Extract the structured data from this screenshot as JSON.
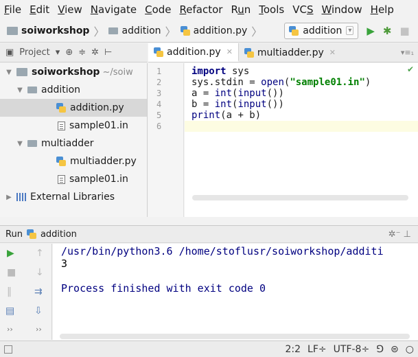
{
  "menubar": {
    "items": [
      {
        "pre": "",
        "u": "F",
        "post": "ile"
      },
      {
        "pre": "",
        "u": "E",
        "post": "dit"
      },
      {
        "pre": "",
        "u": "V",
        "post": "iew"
      },
      {
        "pre": "",
        "u": "N",
        "post": "avigate"
      },
      {
        "pre": "",
        "u": "C",
        "post": "ode"
      },
      {
        "pre": "",
        "u": "R",
        "post": "efactor"
      },
      {
        "pre": "R",
        "u": "u",
        "post": "n"
      },
      {
        "pre": "",
        "u": "T",
        "post": "ools"
      },
      {
        "pre": "VC",
        "u": "S",
        "post": ""
      },
      {
        "pre": "",
        "u": "W",
        "post": "indow"
      },
      {
        "pre": "",
        "u": "H",
        "post": "elp"
      }
    ]
  },
  "navbar": {
    "crumbs": [
      "soiworkshop",
      "addition",
      "addition.py"
    ],
    "run_config": "addition"
  },
  "project": {
    "header_label": "Project",
    "root_name": "soiworkshop",
    "root_path": "~/soiw",
    "tree": [
      {
        "name": "addition"
      },
      {
        "name": "addition.py"
      },
      {
        "name": "sample01.in"
      },
      {
        "name": "multiadder"
      },
      {
        "name": "multiadder.py"
      },
      {
        "name": "sample01.in"
      },
      {
        "name": "External Libraries"
      }
    ]
  },
  "editor": {
    "tabs": [
      {
        "label": "addition.py"
      },
      {
        "label": "multiadder.py"
      }
    ],
    "line_numbers": [
      "1",
      "2",
      "3",
      "4",
      "5",
      "6"
    ]
  },
  "run": {
    "title": "Run",
    "config": "addition",
    "lines": [
      "/usr/bin/python3.6 /home/stoflusr/soiworkshop/additi",
      "3",
      "",
      "Process finished with exit code 0"
    ]
  },
  "status": {
    "position": "2:2",
    "line_sep": "LF÷",
    "encoding": "UTF-8÷"
  },
  "colors": {
    "run_green": "#39a33b",
    "keyword": "#000080",
    "string": "#008000"
  }
}
